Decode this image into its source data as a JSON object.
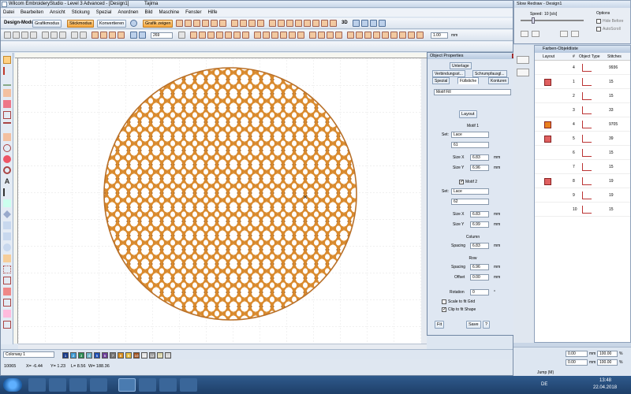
{
  "app": {
    "title": "Wilcom EmbroideryStudio - Level 3 Advanced - [Design1]",
    "tab_label": "Tajima"
  },
  "menu": [
    "Datei",
    "Bearbeiten",
    "Ansicht",
    "Stickung",
    "Spezial",
    "Anordnen",
    "Bild",
    "Maschine",
    "Fenster",
    "Hilfe"
  ],
  "mode_bar": {
    "label": "Design-Modus",
    "grafik": "Grafikmodus",
    "stick": "Stickmodus",
    "konv": "Konvertieren",
    "grafik_zeigen": "Grafik zeigen",
    "zoom_value": "269",
    "three_d": "3D",
    "size_value": "1.00",
    "unit": "mm"
  },
  "colorway": "Colorway 1",
  "palette": [
    {
      "n": "1",
      "c": "#173a8a"
    },
    {
      "n": "2",
      "c": "#3f9bd5"
    },
    {
      "n": "3",
      "c": "#2a8a52"
    },
    {
      "n": "4",
      "c": "#6fb5c9"
    },
    {
      "n": "5",
      "c": "#1f4fb3"
    },
    {
      "n": "6",
      "c": "#6d3f9a"
    },
    {
      "n": "7",
      "c": "#777777"
    },
    {
      "n": "8",
      "c": "#d78c1f"
    },
    {
      "n": "9",
      "c": "#e3bb3f"
    },
    {
      "n": "10",
      "c": "#a1521f"
    },
    {
      "n": "11",
      "c": "#e4e4e4"
    },
    {
      "n": "12",
      "c": "#9b9b9b"
    },
    {
      "n": "13",
      "c": "#d6d1a4"
    },
    {
      "n": "14",
      "c": "#cfcfcf"
    }
  ],
  "status": {
    "stitches": "10065",
    "x": "X= -6.44",
    "y": "Y= 1.23",
    "l": "L= 8.56",
    "w": "W= 188.36"
  },
  "props": {
    "title": "Object Properties",
    "group_label": "Unterlage",
    "tabs_row1": [
      "Verbindungsst...",
      "Schrumpfausgl..."
    ],
    "tabs_row2": [
      "Spezial",
      "Füllstiche",
      "Konturen"
    ],
    "fill_type": "Motif Fill",
    "layout_btn": "Layout",
    "motif1": {
      "header": "Motif 1",
      "set_label": "Set:",
      "set_value": "Lace",
      "motif_value": "61",
      "size_x_label": "Size X",
      "size_x": "6.83",
      "size_y_label": "Size Y",
      "size_y": "6.96",
      "unit": "mm"
    },
    "motif2": {
      "header": "Motif 2",
      "set_label": "Set:",
      "set_value": "Lace",
      "motif_value": "62",
      "size_x_label": "Size X",
      "size_x": "6.83",
      "size_y_label": "Size Y",
      "size_y": "6.99",
      "unit": "mm"
    },
    "column": {
      "header": "Column",
      "spacing_label": "Spacing",
      "spacing": "6.83",
      "unit": "mm"
    },
    "row": {
      "header": "Row",
      "spacing_label": "Spacing",
      "spacing": "6.96",
      "offset_label": "Offset",
      "offset": "0.00",
      "unit": "mm"
    },
    "rotation_label": "Rotation",
    "rotation": "0",
    "rotation_unit": "°",
    "scale_label": "Scale to fit Grid",
    "clip_label": "Clip to fit Shape",
    "fit_btn": "Fit",
    "save_btn": "Save",
    "help_btn": "?"
  },
  "slow_redraw": {
    "title": "Slow Redraw - Design1",
    "speed_label": "Speed:",
    "speed_value": "10 [s/s]",
    "options_label": "Options",
    "opt1": "Hide Before",
    "opt2": "AutoScroll"
  },
  "objlist": {
    "title": "Farben-Objektliste",
    "cols": [
      "Layout",
      "#",
      "Object Type",
      "Stitches"
    ],
    "rows": [
      {
        "n": "4",
        "swatch": "",
        "stitches": "9936"
      },
      {
        "n": "1",
        "swatch": "#e06060",
        "stitches": "15"
      },
      {
        "n": "2",
        "swatch": "",
        "stitches": "15"
      },
      {
        "n": "3",
        "swatch": "",
        "stitches": "33"
      },
      {
        "n": "4",
        "swatch": "#e8801f",
        "stitches": "9705"
      },
      {
        "n": "5",
        "swatch": "#e06060",
        "stitches": "39"
      },
      {
        "n": "6",
        "swatch": "",
        "stitches": "15"
      },
      {
        "n": "7",
        "swatch": "",
        "stitches": "15"
      },
      {
        "n": "8",
        "swatch": "#e06060",
        "stitches": "19"
      },
      {
        "n": "9",
        "swatch": "",
        "stitches": "19"
      },
      {
        "n": "10",
        "swatch": "",
        "stitches": "15"
      }
    ]
  },
  "zoom_panel": {
    "v1": "0.00",
    "v2": "0.00",
    "v3": "100.00",
    "v4": "100.00",
    "unit": "mm",
    "pct": "%"
  },
  "taskbar": {
    "status_text": "Jump (M)",
    "lang": "DE",
    "time": "13:48",
    "date": "22.04.2018"
  }
}
